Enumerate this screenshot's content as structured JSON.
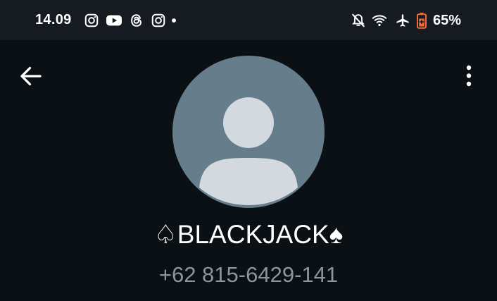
{
  "status_bar": {
    "time": "14.09",
    "notification_icons": [
      "instagram-icon",
      "youtube-icon",
      "threads-icon",
      "instagram-icon",
      "more-notifications-dot"
    ],
    "system_icons": [
      "bell-muted-icon",
      "wifi-icon",
      "airplane-icon",
      "battery-saver-icon"
    ],
    "battery_percent": "65%",
    "battery_color": "#f26b3a"
  },
  "toolbar": {
    "back_icon": "arrow-left-icon",
    "menu_icon": "more-vertical-icon"
  },
  "contact": {
    "avatar_bg": "#667d8c",
    "avatar_fg": "#d3d9de",
    "name": "♤BLACKJACK♠",
    "phone": "+62 815-6429-141"
  }
}
